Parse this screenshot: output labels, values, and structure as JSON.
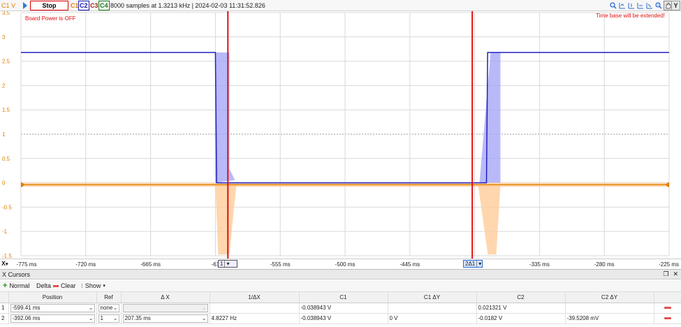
{
  "toolbar": {
    "channel_axis_label": "C1 V",
    "stop_label": "Stop",
    "channels": [
      "C1",
      "C2",
      "C3",
      "C4"
    ],
    "acq_info": "8000 samples at 1.3213 kHz | 2024-02-03 11:31:52.826",
    "icons": [
      "zoom-search-icon",
      "zoom-fit-icon",
      "time-in-icon",
      "time-out-icon",
      "time-fit-icon",
      "magnifier-icon",
      "pan-tool-icon"
    ],
    "y_label": "Y"
  },
  "plot": {
    "status_left": "Board Power is OFF",
    "status_right": "Time base will be extended!",
    "y_ticks": [
      "3.5",
      "3",
      "2.5",
      "2",
      "1.5",
      "1",
      "0.5",
      "0",
      "-0.5",
      "-1",
      "-1.5"
    ],
    "x_ticks": [
      "-775 ms",
      "-720 ms",
      "-665 ms",
      "-61",
      "-555 ms",
      "-500 ms",
      "-445 ms",
      "s",
      "-335 ms",
      "-280 ms",
      "-225 ms"
    ],
    "colors": {
      "c1": "#e08000",
      "c2": "#2020c0",
      "c2_envelope": "#a8a8f8",
      "c1_envelope": "#ffcc99",
      "cursor": "#e01010",
      "grid": "#d8d8d8"
    }
  },
  "chart_data": {
    "type": "line",
    "xlabel": "",
    "ylabel": "V",
    "xlim": [
      -775,
      -225
    ],
    "ylim": [
      -1.5,
      3.5
    ],
    "series": [
      {
        "name": "C2",
        "x": [
          -775,
          -610,
          -609,
          -380,
          -379,
          -225
        ],
        "values": [
          2.68,
          2.68,
          0.0,
          0.0,
          2.68,
          2.68
        ]
      },
      {
        "name": "C1",
        "x": [
          -775,
          -225
        ],
        "values": [
          -0.04,
          -0.04
        ]
      }
    ],
    "cursors": [
      -599.41,
      -392.06
    ]
  },
  "x_axis": {
    "button_label": "X",
    "cursor1_label": "1",
    "cursor2_label": "2Δ1"
  },
  "panel": {
    "title": "X Cursors",
    "normal_label": "Normal",
    "delta_label": "Delta",
    "clear_label": "Clear",
    "show_label": "Show",
    "columns": [
      "",
      "Position",
      "Ref",
      "Δ X",
      "1/ΔX",
      "C1",
      "C1 ΔY",
      "C2",
      "C2 ΔY",
      ""
    ],
    "rows": [
      {
        "index": "1",
        "position": "-599.41 ms",
        "ref": "none",
        "dx": "",
        "inv_dx": "",
        "c1": "-0.038943 V",
        "c1_dy": "",
        "c2": "0.021321 V",
        "c2_dy": ""
      },
      {
        "index": "2",
        "position": "-392.06 ms",
        "ref": "1",
        "dx": "207.35 ms",
        "inv_dx": "4.8227 Hz",
        "c1": "-0.038943 V",
        "c1_dy": "0 V",
        "c2": "-0.0182 V",
        "c2_dy": "-39.5208 mV"
      }
    ]
  }
}
